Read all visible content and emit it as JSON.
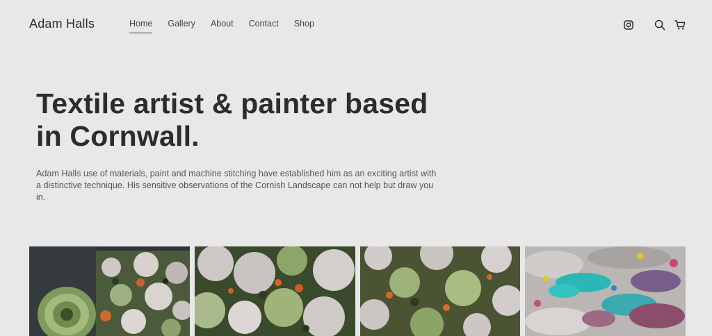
{
  "site": {
    "title": "Adam Halls"
  },
  "nav": {
    "items": [
      {
        "label": "Home",
        "active": true
      },
      {
        "label": "Gallery",
        "active": false
      },
      {
        "label": "About",
        "active": false
      },
      {
        "label": "Contact",
        "active": false
      },
      {
        "label": "Shop",
        "active": false
      }
    ]
  },
  "header_icons": [
    "instagram-icon",
    "search-icon",
    "cart-icon"
  ],
  "hero": {
    "heading_line1": "Textile artist & painter based",
    "heading_line2": "in Cornwall.",
    "description": "Adam Halls use of materials, paint and machine stitching have established him as an  exciting artist with a distinctive technique. His sensitive observations of the Cornish Landscape can not help but draw you in."
  },
  "gallery": {
    "tiles": [
      "artwork-1",
      "artwork-2",
      "artwork-3",
      "artwork-4"
    ]
  },
  "colors": {
    "background": "#e8e8e8",
    "text": "#2c2c2c",
    "muted_text": "#555555"
  }
}
